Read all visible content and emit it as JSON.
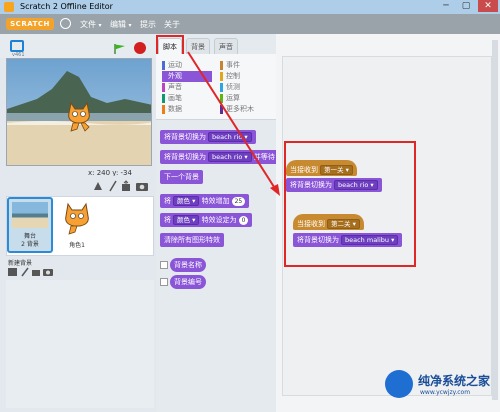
{
  "window": {
    "title": "Scratch 2 Offline Editor",
    "minimize": "─",
    "maximize": "▢",
    "close": "✕"
  },
  "menubar": {
    "logo": "SCRATCH",
    "items": [
      {
        "label": "文件",
        "has_caret": true
      },
      {
        "label": "编辑",
        "has_caret": true
      },
      {
        "label": "提示",
        "has_caret": false
      },
      {
        "label": "关于",
        "has_caret": false
      }
    ]
  },
  "stage": {
    "version": "v461",
    "coords": "x: 240  y: -34"
  },
  "sprites": {
    "stage_label": "舞台",
    "stage_sub": "2 背景",
    "sprite_label": "角色1",
    "new_bg_label": "新建背景"
  },
  "tabs": [
    {
      "label": "脚本",
      "active": true
    },
    {
      "label": "背景",
      "active": false
    },
    {
      "label": "声音",
      "active": false
    }
  ],
  "categories": [
    {
      "label": "运动",
      "color": "#4a6cd4"
    },
    {
      "label": "事件",
      "color": "#c88330"
    },
    {
      "label": "外观",
      "color": "#8a55d7",
      "selected": true
    },
    {
      "label": "控制",
      "color": "#e1a91a"
    },
    {
      "label": "声音",
      "color": "#bb42c3"
    },
    {
      "label": "侦测",
      "color": "#2ca5e2"
    },
    {
      "label": "画笔",
      "color": "#0e9a6c"
    },
    {
      "label": "运算",
      "color": "#5cb712"
    },
    {
      "label": "数据",
      "color": "#ee7d16"
    },
    {
      "label": "更多积木",
      "color": "#632d99"
    }
  ],
  "palette_blocks": {
    "switch_bg": "将背景切换为",
    "bg_value": "beach rio",
    "and_wait": "并等待",
    "next_bg": "下一个背景",
    "change_effect_a": "将",
    "effect_color": "颜色",
    "change_effect_b": "特效增加",
    "change_value": "25",
    "set_effect_b": "特效设定为",
    "set_value": "0",
    "clear_effects": "清除所有图形特效",
    "bg_name": "背景名称",
    "bg_number": "背景编号"
  },
  "scripts": {
    "hat1_label": "当接收到",
    "hat1_value": "第一关",
    "block1_label": "将背景切换为",
    "block1_value": "beach rio",
    "hat2_label": "当接收到",
    "hat2_value": "第二关",
    "block2_label": "将背景切换为",
    "block2_value": "beach malibu"
  },
  "watermark": {
    "text": "纯净系统之家",
    "url": "www.ycwjzy.com"
  },
  "colors": {
    "looks": "#8a55d7",
    "events": "#c88a30",
    "highlight": "#e02727"
  }
}
